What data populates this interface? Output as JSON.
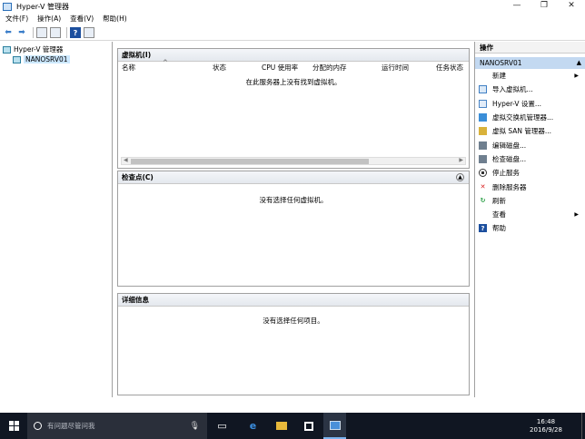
{
  "window": {
    "title": "Hyper-V 管理器",
    "minimize": "—",
    "maximize": "❐",
    "close": "✕"
  },
  "menu": {
    "items": [
      "文件(F)",
      "操作(A)",
      "查看(V)",
      "帮助(H)"
    ]
  },
  "tree": {
    "root": "Hyper-V 管理器",
    "server": "NANOSRV01"
  },
  "vm_panel": {
    "title": "虚拟机(I)",
    "columns": [
      "名称",
      "状态",
      "CPU 使用率",
      "分配的内存",
      "运行时间",
      "任务状态"
    ],
    "empty_text": "在此服务器上没有找到虚拟机。"
  },
  "checkpoint_panel": {
    "title": "检查点(C)",
    "empty_text": "没有选择任何虚拟机。"
  },
  "details_panel": {
    "title": "详细信息",
    "empty_text": "没有选择任何项目。"
  },
  "actions": {
    "title": "操作",
    "server": "NANOSRV01",
    "items": [
      {
        "label": "新建",
        "icon": "none",
        "submenu": true
      },
      {
        "label": "导入虚拟机...",
        "icon": "import-icon"
      },
      {
        "label": "Hyper-V 设置...",
        "icon": "settings-icon"
      },
      {
        "label": "虚拟交换机管理器...",
        "icon": "switch-icon"
      },
      {
        "label": "虚拟 SAN 管理器...",
        "icon": "san-icon"
      },
      {
        "label": "编辑磁盘...",
        "icon": "disk-edit-icon"
      },
      {
        "label": "检查磁盘...",
        "icon": "disk-inspect-icon"
      },
      {
        "label": "停止服务",
        "icon": "stop-icon"
      },
      {
        "label": "删除服务器",
        "icon": "delete-icon"
      },
      {
        "label": "刷新",
        "icon": "refresh-icon"
      },
      {
        "label": "查看",
        "icon": "none",
        "submenu": true
      },
      {
        "label": "帮助",
        "icon": "help-icon"
      }
    ]
  },
  "taskbar": {
    "search_placeholder": "有问题尽管问我",
    "time": "16:48",
    "date": "2016/9/28"
  }
}
